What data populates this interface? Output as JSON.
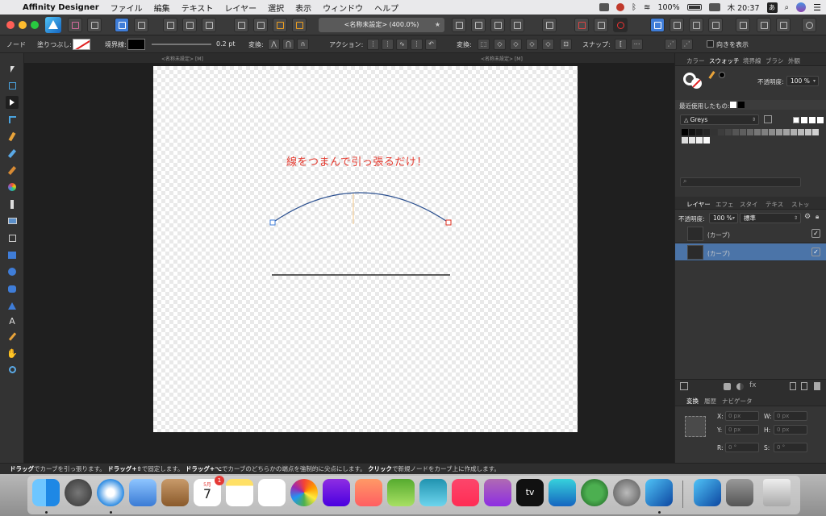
{
  "menubar": {
    "apple": "",
    "app_name": "Affinity Designer",
    "items": [
      "ファイル",
      "編集",
      "テキスト",
      "レイヤー",
      "選択",
      "表示",
      "ウィンドウ",
      "ヘルプ"
    ],
    "battery_pct": "100%",
    "clock": "木 20:37",
    "input_mode": "あ"
  },
  "toolbar": {
    "doc_title": "<名称未設定> (400.0%)",
    "star": "★"
  },
  "context": {
    "node_label": "ノード",
    "fill_label": "塗りつぶし:",
    "stroke_label": "境界線:",
    "stroke_width": "0.2 pt",
    "transform_label": "変換:",
    "action_label": "アクション:",
    "convert_label": "変換:",
    "snap_label": "スナップ:",
    "show_direction_label": "向きを表示"
  },
  "doc_tabs": {
    "left": "<名称未設定> [M]",
    "right": "<名称未設定> [M]"
  },
  "canvas": {
    "annotation": "線をつまんで引っ張るだけ！",
    "curve_color": "#2a4f8f",
    "line_color": "#000000",
    "annotation_color": "#e43a2f"
  },
  "swatch_panel": {
    "tabs": [
      "カラー",
      "スウォッチ",
      "境界線",
      "ブラシ",
      "外観"
    ],
    "active_tab": "スウォッチ",
    "opacity_label": "不透明度:",
    "opacity_value": "100 %",
    "recent_label": "最近使用したもの:",
    "palette_name": "Greys",
    "palette_icon": "triangle-icon",
    "search_icon": "search-icon"
  },
  "layers_panel": {
    "tabs": [
      "レイヤー",
      "エフェ",
      "スタイ",
      "テキス",
      "ストッ"
    ],
    "active_tab": "レイヤー",
    "opacity_label": "不透明度:",
    "opacity_value": "100 %",
    "blend_mode": "標準",
    "rows": [
      {
        "name": "(カーブ)",
        "selected": false,
        "visible": "✓"
      },
      {
        "name": "(カーブ)",
        "selected": true,
        "visible": "✓"
      }
    ]
  },
  "transform_panel": {
    "tabs": [
      "変換",
      "履歴",
      "ナビゲータ"
    ],
    "active_tab": "変換",
    "x_label": "X:",
    "x_value": "0 px",
    "y_label": "Y:",
    "y_value": "0 px",
    "w_label": "W:",
    "w_value": "0 px",
    "h_label": "H:",
    "h_value": "0 px",
    "r_label": "R:",
    "r_value": "0 °",
    "s_label": "S:",
    "s_value": "0 °"
  },
  "status": {
    "t1": "ドラッグ",
    "t2": "でカーブを引っ張ります。",
    "t3": "ドラッグ+⇧",
    "t4": "で固定します。",
    "t5": "ドラッグ+⌥",
    "t6": "でカーブのどちらかの端点を強制的に尖点にします。",
    "t7": "クリック",
    "t8": "で新規ノードをカーブ上に作成します。"
  },
  "dock": {
    "calendar_month": "5月",
    "calendar_day": "7",
    "calendar_badge": "1",
    "appletv_label": "tv"
  }
}
